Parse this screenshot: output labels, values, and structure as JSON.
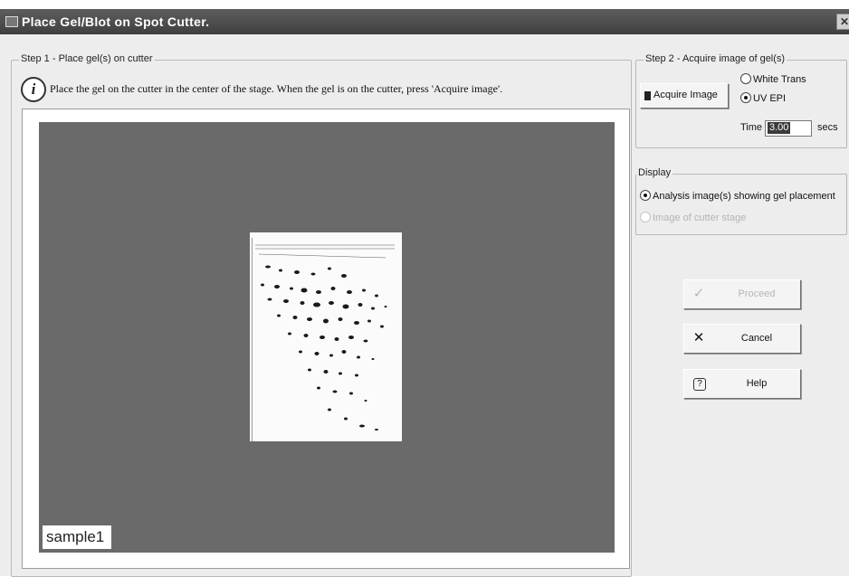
{
  "window": {
    "title": "Place Gel/Blot on Spot Cutter.",
    "close_glyph": "✕"
  },
  "step1": {
    "legend": "Step 1 - Place gel(s) on cutter",
    "instruction": "Place the gel on the cutter in the center of the stage. When the gel is on the cutter, press 'Acquire image'.",
    "info_icon": "i",
    "stage": {
      "sample_label": "sample1"
    }
  },
  "step2": {
    "legend": "Step 2 - Acquire image of gel(s)",
    "acquire_button": "Acquire Image",
    "options": [
      {
        "label": "White Trans",
        "selected": false
      },
      {
        "label": "UV EPI",
        "selected": true
      }
    ],
    "time_label": "Time",
    "time_value": "3.00",
    "time_unit": "secs"
  },
  "display": {
    "legend": "Display",
    "options": [
      {
        "label": "Analysis image(s) showing gel placement",
        "selected": true,
        "enabled": true
      },
      {
        "label": "Image of cutter stage",
        "selected": false,
        "enabled": false
      }
    ]
  },
  "actions": {
    "proceed": {
      "label": "Proceed",
      "icon": "checkmark-icon",
      "enabled": false
    },
    "cancel": {
      "label": "Cancel",
      "icon": "x-icon"
    },
    "help": {
      "label": "Help",
      "icon": "help-icon"
    }
  },
  "colors": {
    "titlebar": "#4a4a4a",
    "stage": "#6a6a6a",
    "window_bg": "#ededed"
  }
}
